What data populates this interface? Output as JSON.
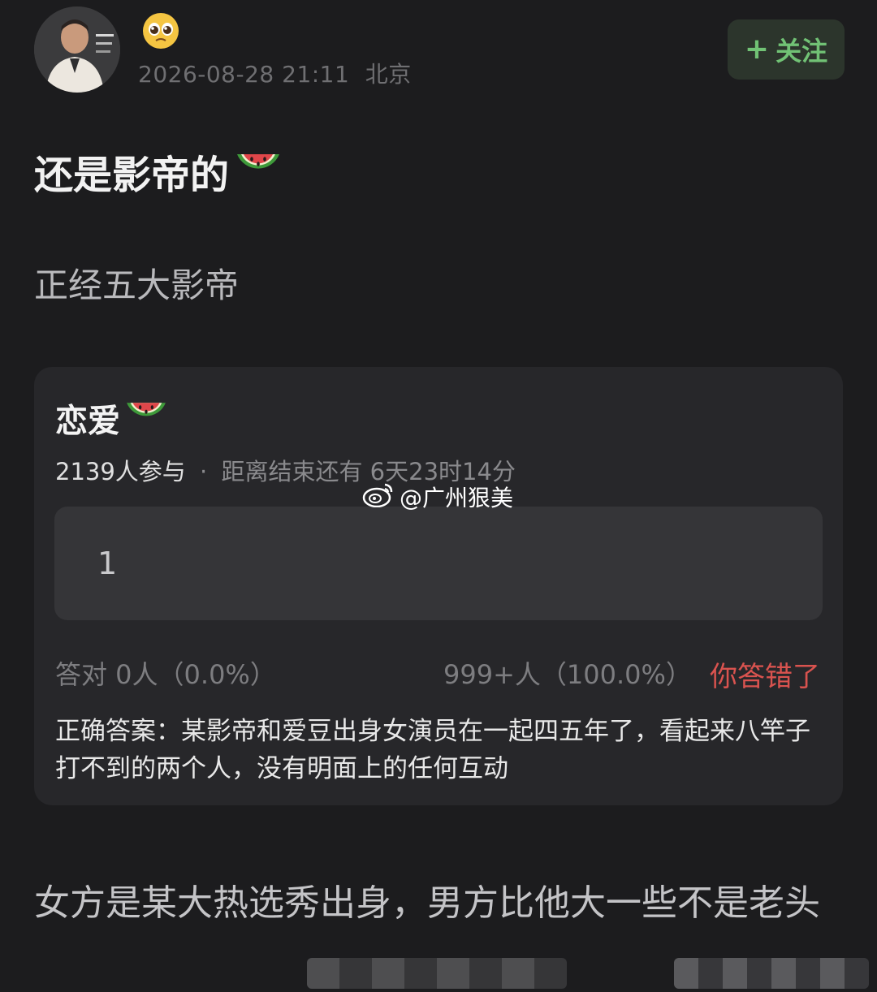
{
  "post": {
    "timestamp": "2026-08-28 21:11",
    "location": "北京",
    "emoji_badge_icon": "pleading-face-icon",
    "title": "还是影帝的",
    "title_icon": "watermelon-icon",
    "subtitle": "正经五大影帝"
  },
  "follow": {
    "label": "关注",
    "icon": "plus-icon",
    "color": "#71c275"
  },
  "quiz": {
    "title": "恋爱",
    "title_icon": "watermelon-icon",
    "participants": "2139人参与",
    "separator": "·",
    "remaining": "距离结束还有 6天23时14分",
    "option_label": "1",
    "correct_stat": "答对  0人（0.0%）",
    "other_stat": "999+人（100.0%）",
    "result": "你答错了",
    "result_color": "#d9534f",
    "answer": "正确答案：某影帝和爱豆出身女演员在一起四五年了，看起来八竿子打不到的两个人，没有明面上的任何互动"
  },
  "watermark": {
    "icon": "weibo-icon",
    "text": "@广州狠美"
  },
  "body": {
    "text": "女方是某大热选秀出身，男方比他大一些不是老头"
  }
}
